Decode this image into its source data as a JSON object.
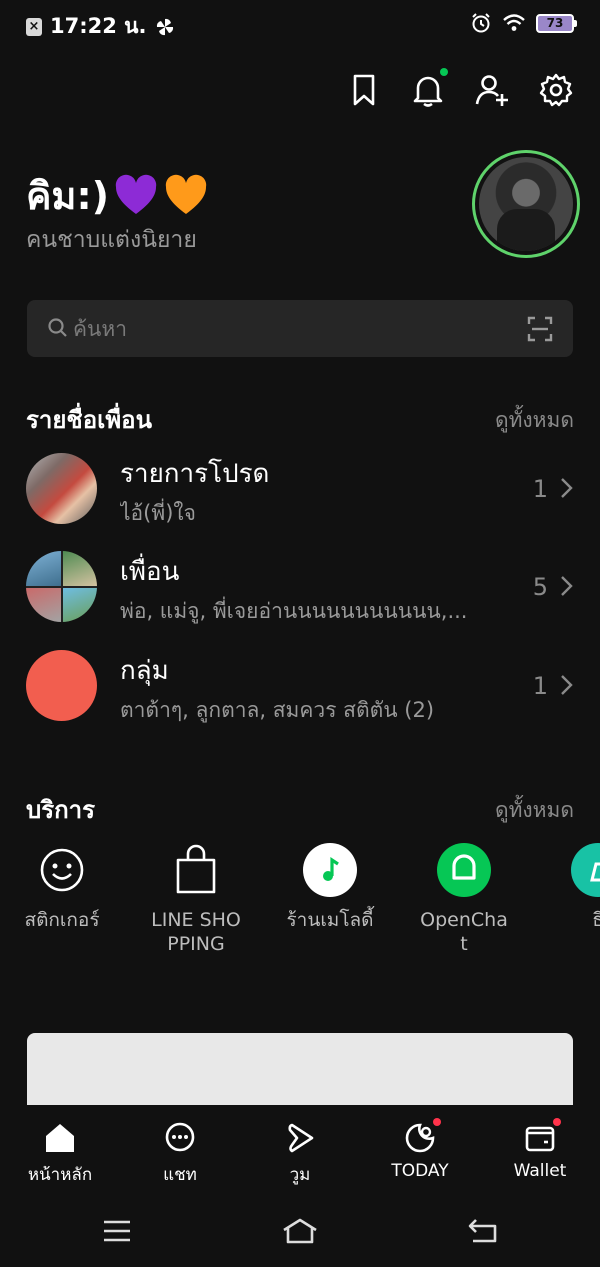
{
  "status_bar": {
    "time": "17:22 น.",
    "left_icons": [
      "x-box-icon",
      "pinwheel-icon"
    ],
    "right_icons": [
      "alarm-icon",
      "wifi-icon",
      "battery-icon"
    ],
    "battery_level": "73"
  },
  "top_icons": [
    "bookmark-icon",
    "bell-icon",
    "add-friend-icon",
    "settings-icon"
  ],
  "profile": {
    "name": "คิม:)",
    "emojis": [
      "purple-heart-icon",
      "orange-heart-icon"
    ],
    "status": "คนชาบแต่งนิยาย",
    "avatar_ring_color": "#5fd36b"
  },
  "search": {
    "placeholder": "ค้นหา"
  },
  "friends_section": {
    "title": "รายชื่อเพื่อน",
    "see_all": "ดูทั้งหมด",
    "rows": [
      {
        "title": "รายการโปรด",
        "subtitle": "ไอ้(พี่)ใจ",
        "count": "1"
      },
      {
        "title": "เพื่อน",
        "subtitle": "พ่อ, แม่จู, พี่เจยอ่านนนนนนนนนนน,...",
        "count": "5"
      },
      {
        "title": "กลุ่ม",
        "subtitle": "ตาต้าๆ, ลูกตาล, สมควร สติตัน (2)",
        "count": "1"
      }
    ]
  },
  "services_section": {
    "title": "บริการ",
    "see_all": "ดูทั้งหมด",
    "items": [
      {
        "label": "สติกเกอร์",
        "icon": "smiley-icon"
      },
      {
        "label": "LINE SHOPPING",
        "icon": "shopping-bag-icon"
      },
      {
        "label": "ร้านเมโลดี้",
        "icon": "melody-note-icon"
      },
      {
        "label": "OpenChat",
        "icon": "openchat-icon"
      },
      {
        "label": "ธี",
        "icon": "theme-icon"
      }
    ]
  },
  "bottom_nav": [
    {
      "label": "หน้าหลัก",
      "icon": "home-icon",
      "badge": false
    },
    {
      "label": "แชท",
      "icon": "chat-icon",
      "badge": false
    },
    {
      "label": "วูม",
      "icon": "voom-icon",
      "badge": false
    },
    {
      "label": "TODAY",
      "icon": "today-icon",
      "badge": true
    },
    {
      "label": "Wallet",
      "icon": "wallet-icon",
      "badge": true
    }
  ],
  "colors": {
    "background": "#111111",
    "accent_green": "#06c755",
    "badge_red": "#ff334b",
    "group_avatar": "#f25e4f"
  }
}
